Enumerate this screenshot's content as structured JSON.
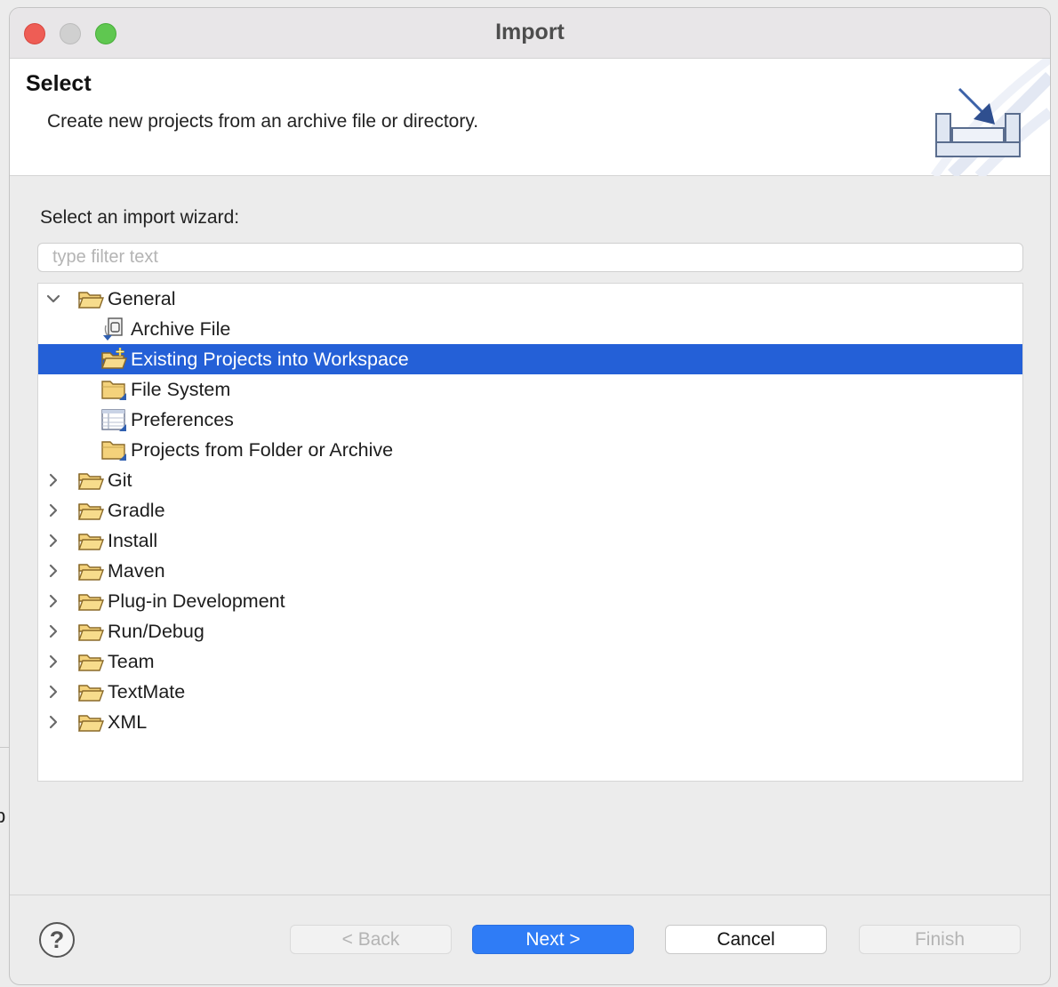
{
  "window": {
    "title": "Import"
  },
  "header": {
    "title": "Select",
    "description": "Create new projects from an archive file or directory."
  },
  "wizard": {
    "label": "Select an import wizard:",
    "filter_placeholder": "type filter text",
    "filter_value": ""
  },
  "tree": {
    "rows": [
      {
        "label": "General",
        "level": 0,
        "expanded": true,
        "icon": "folder-open-icon"
      },
      {
        "label": "Archive File",
        "level": 1,
        "icon": "archive-file-icon"
      },
      {
        "label": "Existing Projects into Workspace",
        "level": 1,
        "icon": "new-project-folder-icon",
        "selected": true
      },
      {
        "label": "File System",
        "level": 1,
        "icon": "folder-icon"
      },
      {
        "label": "Preferences",
        "level": 1,
        "icon": "preferences-icon"
      },
      {
        "label": "Projects from Folder or Archive",
        "level": 1,
        "icon": "folder-icon"
      },
      {
        "label": "Git",
        "level": 0,
        "expanded": false,
        "icon": "folder-open-icon"
      },
      {
        "label": "Gradle",
        "level": 0,
        "expanded": false,
        "icon": "folder-open-icon"
      },
      {
        "label": "Install",
        "level": 0,
        "expanded": false,
        "icon": "folder-open-icon"
      },
      {
        "label": "Maven",
        "level": 0,
        "expanded": false,
        "icon": "folder-open-icon"
      },
      {
        "label": "Plug-in Development",
        "level": 0,
        "expanded": false,
        "icon": "folder-open-icon"
      },
      {
        "label": "Run/Debug",
        "level": 0,
        "expanded": false,
        "icon": "folder-open-icon"
      },
      {
        "label": "Team",
        "level": 0,
        "expanded": false,
        "icon": "folder-open-icon"
      },
      {
        "label": "TextMate",
        "level": 0,
        "expanded": false,
        "icon": "folder-open-icon"
      },
      {
        "label": "XML",
        "level": 0,
        "expanded": false,
        "icon": "folder-open-icon"
      }
    ]
  },
  "buttons": {
    "help": "?",
    "back": "< Back",
    "next": "Next >",
    "cancel": "Cancel",
    "finish": "Finish"
  },
  "background_window": {
    "partial_char": "p"
  },
  "colors": {
    "selection": "#2460d7",
    "primary_button": "#2f7cf6",
    "folder": "#f2c862"
  }
}
